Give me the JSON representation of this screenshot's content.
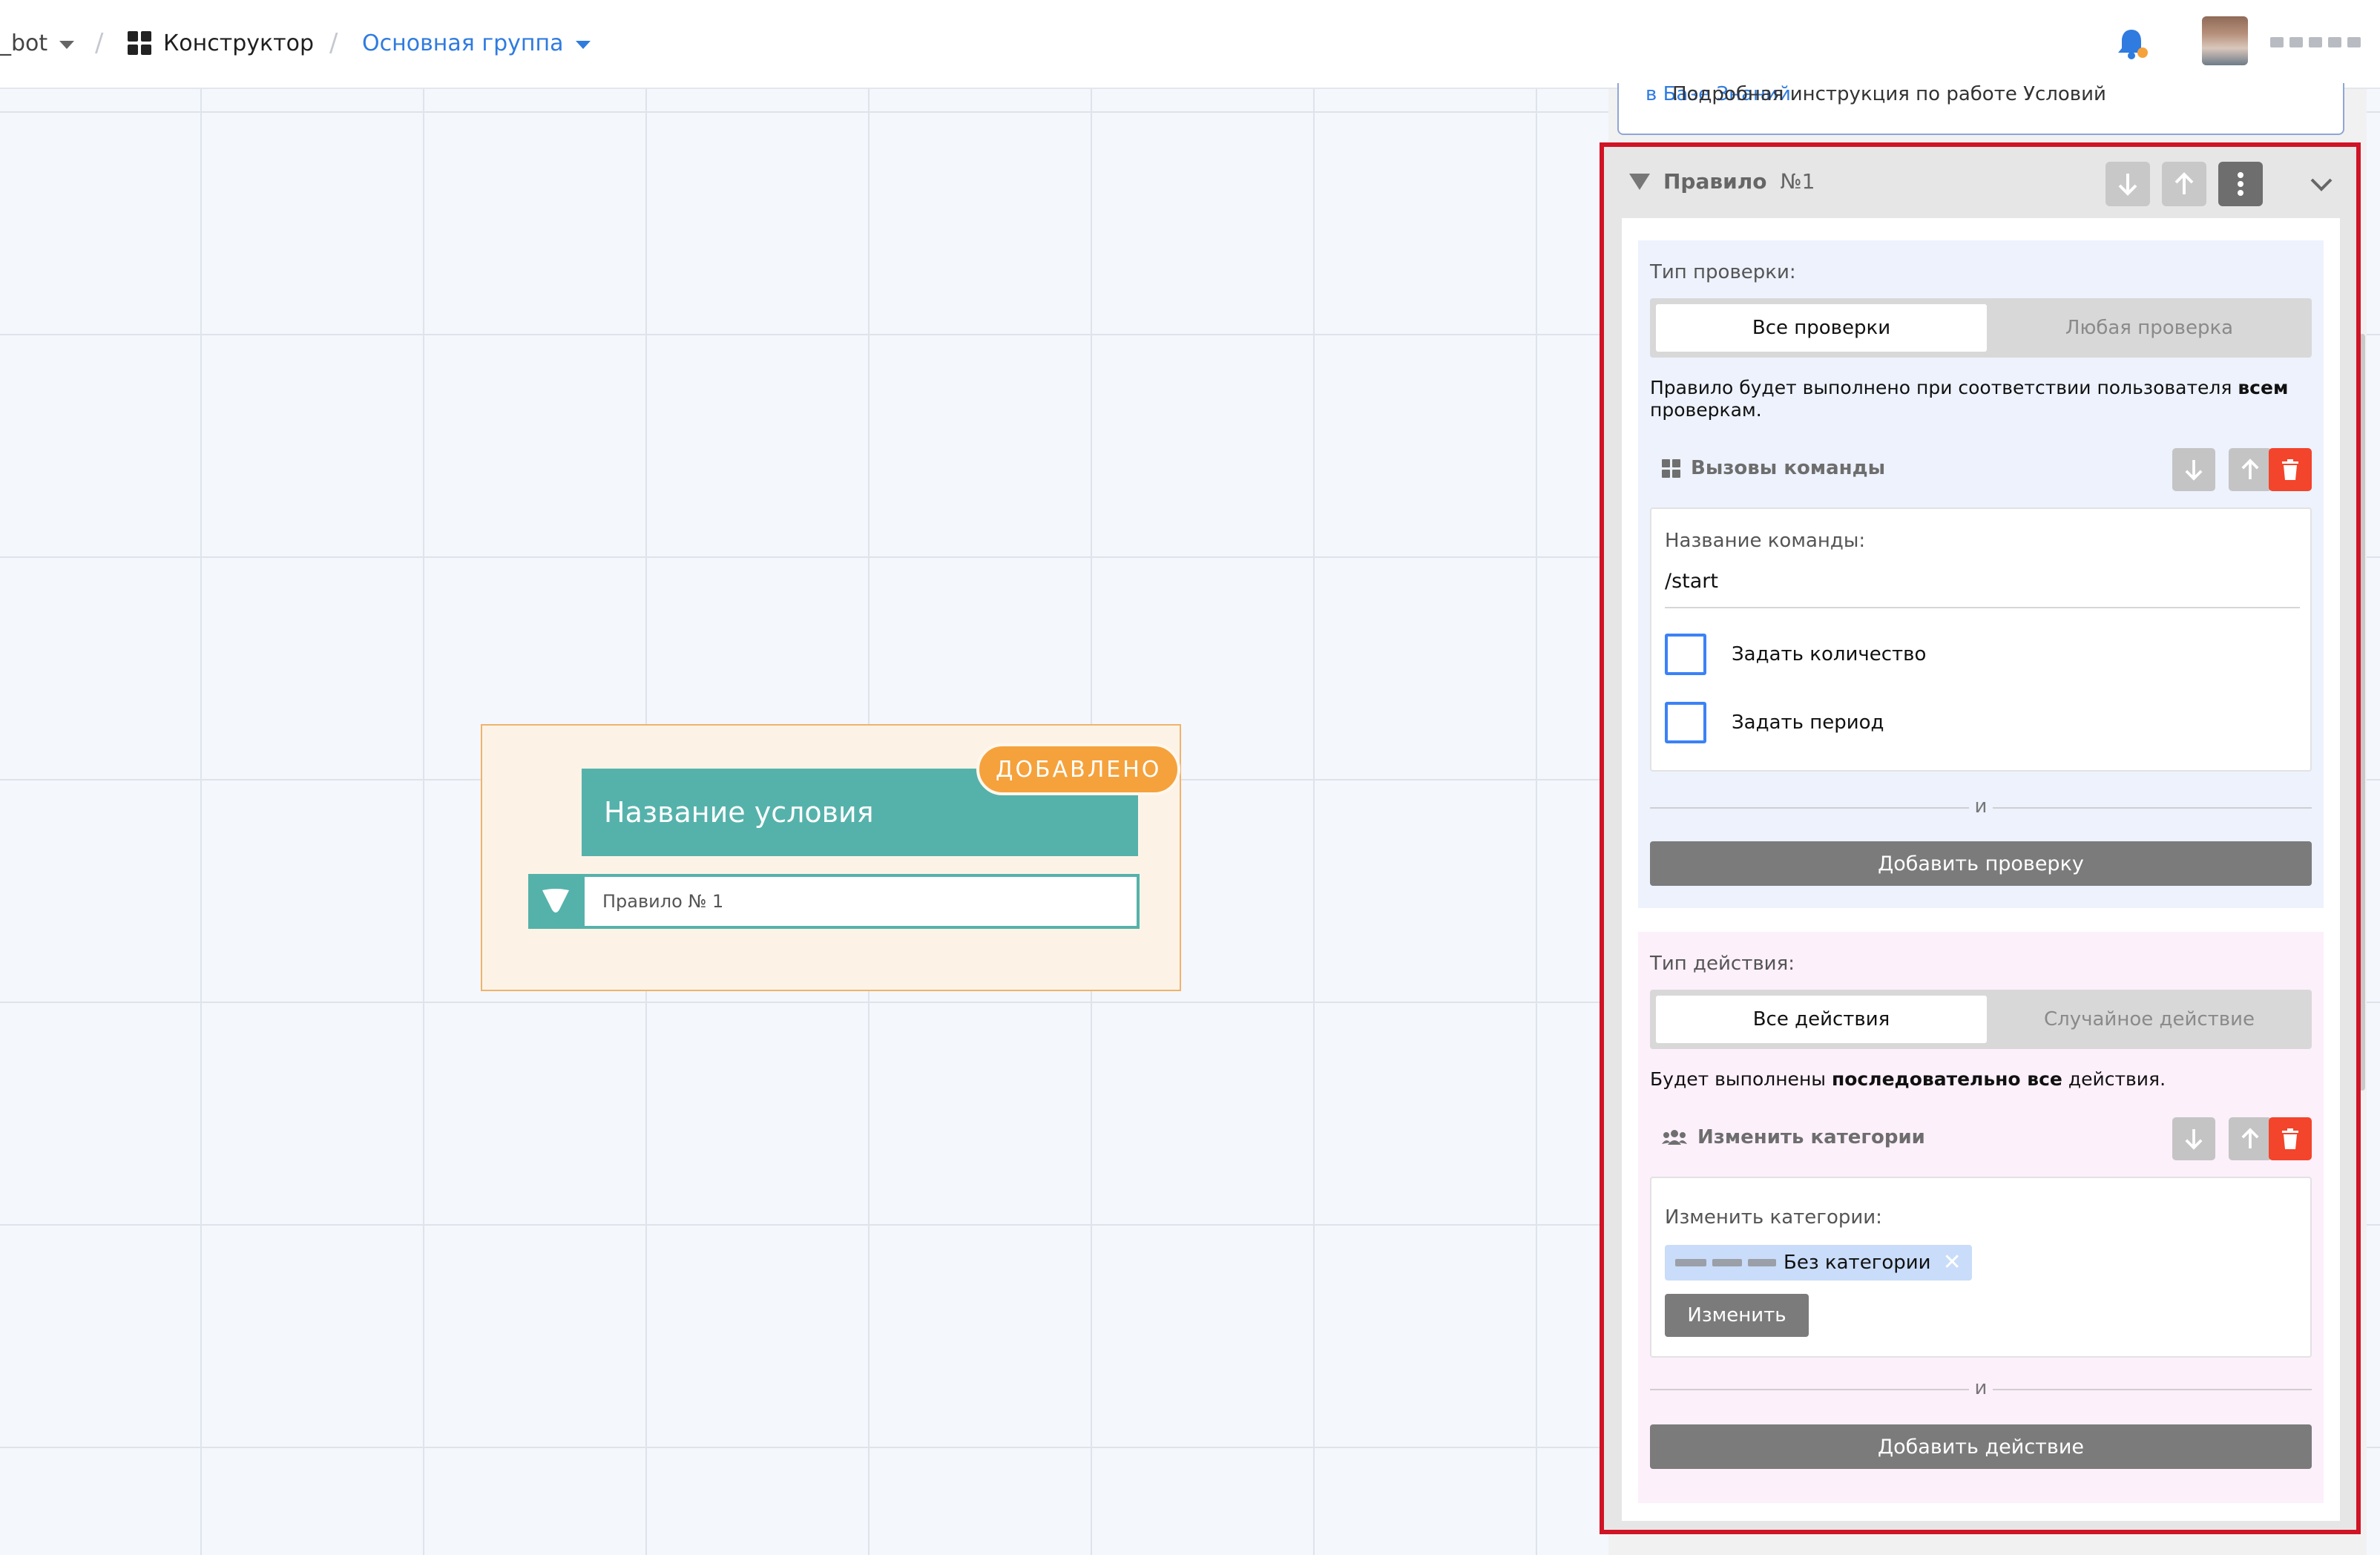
{
  "header": {
    "bot_label": "_bot",
    "crumb_separator": "/",
    "constructor_label": "Конструктор",
    "group_label": "Основная группа"
  },
  "canvas": {
    "node_title": "Название условия",
    "node_badge": "ДОБАВЛЕНО",
    "node_rule_label": "Правило № 1"
  },
  "panel": {
    "top_note_text": "Подробная инструкция по работе Условий ",
    "top_note_link": "в Базе Знаний",
    "top_note_end": ".",
    "rule": {
      "title": "Правило",
      "number": "№1"
    },
    "check_section": {
      "type_label": "Тип проверки:",
      "options": [
        "Все проверки",
        "Любая проверка"
      ],
      "selected": "Все проверки",
      "description_prefix": "Правило будет выполнено при соответствии пользователя ",
      "description_bold": "всем",
      "description_suffix": " проверкам.",
      "item": {
        "title": "Вызовы команды",
        "field_label": "Название команды:",
        "field_value": "/start",
        "checkbox_count_label": "Задать количество",
        "checkbox_period_label": "Задать период"
      },
      "divider_label": "и",
      "add_button": "Добавить проверку"
    },
    "action_section": {
      "type_label": "Тип действия:",
      "options": [
        "Все действия",
        "Случайное действие"
      ],
      "selected": "Все действия",
      "description_prefix": "Будет выполнены ",
      "description_bold": "последовательно все",
      "description_suffix": " действия.",
      "item": {
        "title": "Изменить категории",
        "field_label": "Изменить категории:",
        "tag_label": "Без категории",
        "tag_remove": "✕",
        "change_button": "Изменить"
      },
      "divider_label": "и",
      "add_button": "Добавить действие"
    }
  },
  "colors": {
    "accent_blue": "#2f7be0",
    "teal": "#55b2ab",
    "badge_orange": "#f5a23c",
    "highlight_red": "#d01325",
    "delete_red": "#f3442c"
  }
}
